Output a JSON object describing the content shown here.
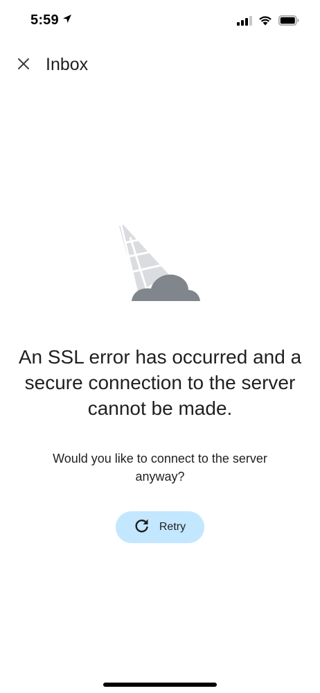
{
  "status_bar": {
    "time": "5:59",
    "icons": [
      "location-arrow-icon",
      "cellular-signal-icon",
      "wifi-icon",
      "battery-icon"
    ]
  },
  "app_bar": {
    "close_icon": "close-icon",
    "title": "Inbox"
  },
  "illustration": {
    "icon": "broken-connection-icon"
  },
  "error": {
    "title": "An SSL error has occurred and a secure connection to the server cannot be made.",
    "question": "Would you like to connect to the server anyway?"
  },
  "retry_button": {
    "icon": "refresh-icon",
    "label": "Retry"
  },
  "colors": {
    "accent_button_bg": "#c2e7ff",
    "text": "#1f1f1f",
    "illustration_cloud": "#80868b",
    "illustration_beam": "#dadce0"
  }
}
